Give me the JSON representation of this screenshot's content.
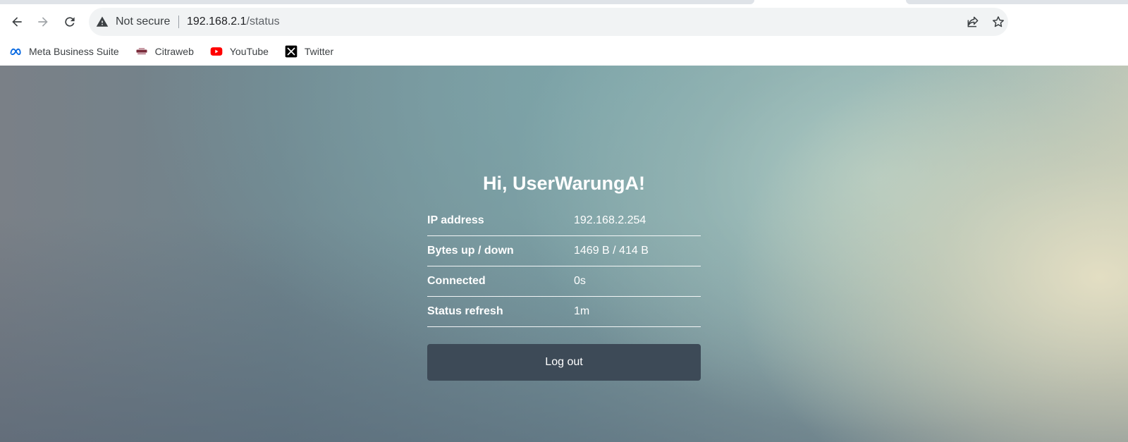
{
  "browser": {
    "security_label": "Not secure",
    "url_host": "192.168.2.1",
    "url_path": "/status",
    "icons": {
      "back": "arrow-left-icon",
      "forward": "arrow-right-icon",
      "reload": "reload-icon",
      "security": "warning-triangle-icon",
      "share": "share-icon",
      "bookmark_star": "star-icon"
    },
    "bookmarks": [
      {
        "label": "Meta Business Suite",
        "icon": "meta-icon"
      },
      {
        "label": "Citraweb",
        "icon": "citraweb-icon"
      },
      {
        "label": "YouTube",
        "icon": "youtube-icon"
      },
      {
        "label": "Twitter",
        "icon": "x-twitter-icon"
      }
    ]
  },
  "page": {
    "greeting": "Hi, UserWarungA!",
    "rows": [
      {
        "label": "IP address",
        "value": "192.168.2.254"
      },
      {
        "label": "Bytes up / down",
        "value": "1469 B / 414 B"
      },
      {
        "label": "Connected",
        "value": "0s"
      },
      {
        "label": "Status refresh",
        "value": "1m"
      }
    ],
    "logout_label": "Log out"
  },
  "colors": {
    "button_bg": "#3d4a57",
    "text_on_page": "#ffffff",
    "youtube_red": "#ff0000",
    "meta_blue": "#0668e1"
  }
}
